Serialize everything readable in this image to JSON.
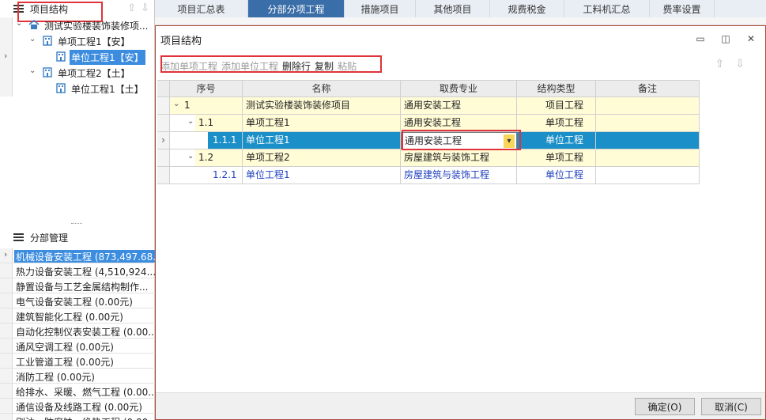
{
  "left_panel": {
    "header_title": "项目结构",
    "tree": [
      {
        "label": "测试实验楼装饰装修项...",
        "twist": "⌄",
        "icon": "house-icon",
        "level": 0,
        "selected": false
      },
      {
        "label": "单项工程1【安】",
        "twist": "⌄",
        "icon": "building-icon",
        "level": 1,
        "selected": false
      },
      {
        "label": "单位工程1【安】",
        "twist": "",
        "icon": "building-icon",
        "level": 2,
        "selected": true
      },
      {
        "label": "单项工程2【土】",
        "twist": "⌄",
        "icon": "building-icon",
        "level": 1,
        "selected": false
      },
      {
        "label": "单位工程1【土】",
        "twist": "",
        "icon": "building-icon",
        "level": 2,
        "selected": false
      }
    ],
    "fenbu_title": "分部管理",
    "fenbu_items": [
      "机械设备安装工程 (873,497.68...",
      "热力设备安装工程 (4,510,924....",
      "静置设备与工艺金属结构制作...",
      "电气设备安装工程 (0.00元)",
      "建筑智能化工程 (0.00元)",
      "自动化控制仪表安装工程 (0.00...",
      "通风空调工程 (0.00元)",
      "工业管道工程 (0.00元)",
      "消防工程 (0.00元)",
      "给排水、采暖、燃气工程 (0.00...",
      "通信设备及线路工程 (0.00元)",
      "刷油、防腐蚀、绝热工程 (0.00..."
    ]
  },
  "tabs": [
    "项目汇总表",
    "分部分项工程",
    "措施项目",
    "其他项目",
    "规费税金",
    "工料机汇总",
    "费率设置"
  ],
  "active_tab": "分部分项工程",
  "dialog": {
    "title": "项目结构",
    "controls": [
      "▭",
      "◫",
      "✕"
    ],
    "toolbar": [
      {
        "label": "添加单项工程",
        "enabled": false
      },
      {
        "label": "添加单位工程",
        "enabled": false
      },
      {
        "label": "删除行",
        "enabled": true
      },
      {
        "label": "复制",
        "enabled": true
      },
      {
        "label": "粘贴",
        "enabled": false
      }
    ],
    "columns": [
      "序号",
      "名称",
      "取费专业",
      "结构类型",
      "备注"
    ],
    "rows": [
      {
        "seq": "1",
        "name": "测试实验楼装饰装修项目",
        "fee": "通用安装工程",
        "type": "项目工程",
        "note": "",
        "level": 0,
        "twist": "⌄",
        "style": "yellow"
      },
      {
        "seq": "1.1",
        "name": "单项工程1",
        "fee": "通用安装工程",
        "type": "单项工程",
        "note": "",
        "level": 1,
        "twist": "⌄",
        "style": "yellow"
      },
      {
        "seq": "1.1.1",
        "name": "单位工程1",
        "fee": "通用安装工程",
        "type": "单位工程",
        "note": "",
        "level": 2,
        "twist": "",
        "style": "selected"
      },
      {
        "seq": "1.2",
        "name": "单项工程2",
        "fee": "房屋建筑与装饰工程",
        "type": "单项工程",
        "note": "",
        "level": 1,
        "twist": "⌄",
        "style": "yellow"
      },
      {
        "seq": "1.2.1",
        "name": "单位工程1",
        "fee": "房屋建筑与装饰工程",
        "type": "单位工程",
        "note": "",
        "level": 2,
        "twist": "",
        "style": "blue"
      }
    ],
    "ok_label": "确定(O)",
    "cancel_label": "取消(C)"
  }
}
